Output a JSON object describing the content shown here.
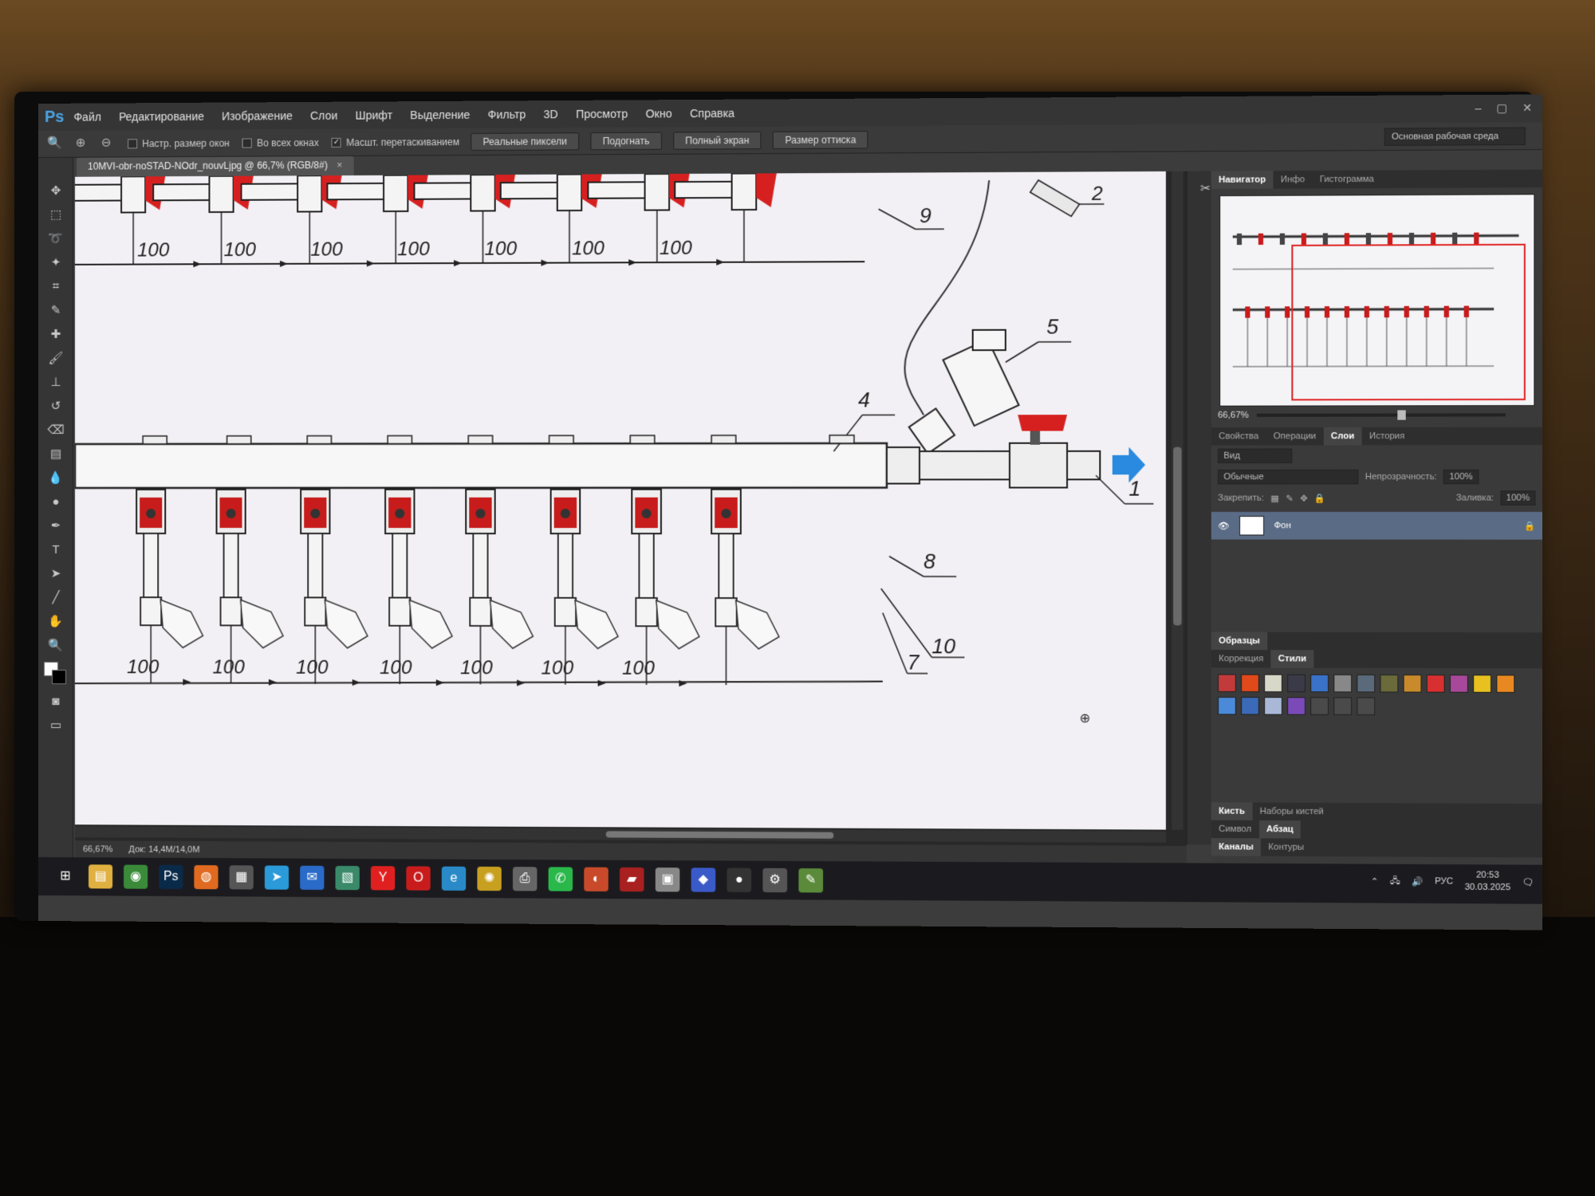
{
  "app": {
    "logo": "Ps"
  },
  "menu": [
    "Файл",
    "Редактирование",
    "Изображение",
    "Слои",
    "Шрифт",
    "Выделение",
    "Фильтр",
    "3D",
    "Просмотр",
    "Окно",
    "Справка"
  ],
  "window_controls": [
    "–",
    "▢",
    "✕"
  ],
  "options": {
    "resize_windows": "Настр. размер окон",
    "all_windows": "Во всех окнах",
    "scrubby_zoom": "Масшт. перетаскиванием",
    "btn_actual_pixels": "Реальные пиксели",
    "btn_fit": "Подогнать",
    "btn_fill_screen": "Полный экран",
    "btn_print_size": "Размер оттиска",
    "workspace": "Основная рабочая среда"
  },
  "document_tab": {
    "title": "10MVI-obr-noSTAD-NOdr_nouvLjpg @ 66,7% (RGB/8#)",
    "close": "×"
  },
  "drawing": {
    "top_dims": [
      "100",
      "100",
      "100",
      "100",
      "100",
      "100",
      "100"
    ],
    "bottom_dims": [
      "100",
      "100",
      "100",
      "100",
      "100",
      "100",
      "100"
    ],
    "callouts": {
      "c1": "1",
      "c2": "2",
      "c4": "4",
      "c5": "5",
      "c7": "7",
      "c8": "8",
      "c9": "9",
      "c10": "10"
    }
  },
  "status": {
    "zoom": "66,67%",
    "doc": "Док: 14,4M/14,0M"
  },
  "navigator": {
    "tabs": [
      "Навигатор",
      "Инфо",
      "Гистограмма"
    ],
    "zoom": "66,67%"
  },
  "layers": {
    "tabs": [
      "Свойства",
      "Операции",
      "Слои",
      "История"
    ],
    "filter": "Вид",
    "blend": "Обычные",
    "opacity_label": "Непрозрачность:",
    "opacity_value": "100%",
    "lock_label": "Закрепить:",
    "fill_label": "Заливка:",
    "fill_value": "100%",
    "layer_name": "Фон"
  },
  "swatches": {
    "header": "Образцы",
    "tabs": [
      "Коррекция",
      "Стили"
    ],
    "colors": [
      "#c23a3a",
      "#e04a1a",
      "#d8d8c8",
      "#3a3a48",
      "#3a72c8",
      "#888888",
      "#5a6a7a",
      "#6a6a3a",
      "#c88a2a",
      "#d83030",
      "#a8489a",
      "#e8c020",
      "#e88820",
      "#4a8ad8",
      "#3a6ab8",
      "#aab8d8",
      "#7a4ab8",
      "#4a4a4a",
      "#4a4a4a",
      "#4a4a4a"
    ]
  },
  "bottom_panels": {
    "row1": [
      "Кисть",
      "Наборы кистей"
    ],
    "row2": [
      "Символ",
      "Абзац"
    ],
    "row3": [
      "Каналы",
      "Контуры"
    ]
  },
  "taskbar": {
    "icons": [
      "windows-start",
      "file-explorer",
      "chrome",
      "photoshop",
      "firefox",
      "store",
      "telegram",
      "mail",
      "app-green",
      "yandex",
      "opera",
      "edge",
      "app-sun",
      "printer",
      "whatsapp",
      "app-rainbow",
      "app-red",
      "app-box",
      "app-blue",
      "app-dark",
      "settings",
      "app-note"
    ],
    "lang": "РУС",
    "time": "20:53",
    "date": "30.03.2025"
  }
}
